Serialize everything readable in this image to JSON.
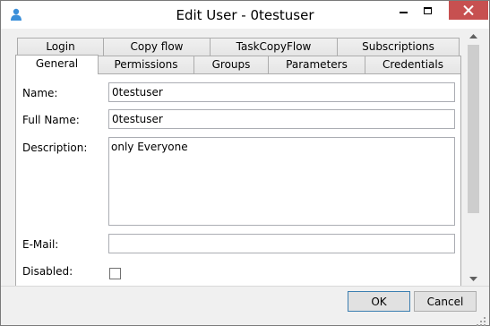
{
  "window": {
    "title": "Edit User - 0testuser"
  },
  "tabs_row1": [
    "Login",
    "Copy flow",
    "TaskCopyFlow",
    "Subscriptions"
  ],
  "tabs_row2": [
    "General",
    "Permissions",
    "Groups",
    "Parameters",
    "Credentials"
  ],
  "active_tab": "General",
  "form": {
    "name_label": "Name:",
    "name_value": "0testuser",
    "fullname_label": "Full Name:",
    "fullname_value": "0testuser",
    "description_label": "Description:",
    "description_value": "only Everyone",
    "email_label": "E-Mail:",
    "email_value": "",
    "disabled_label": "Disabled:",
    "disabled_checked": false
  },
  "buttons": {
    "ok": "OK",
    "cancel": "Cancel"
  },
  "colors": {
    "close_button": "#c75050",
    "accent": "#3c7fb1"
  }
}
